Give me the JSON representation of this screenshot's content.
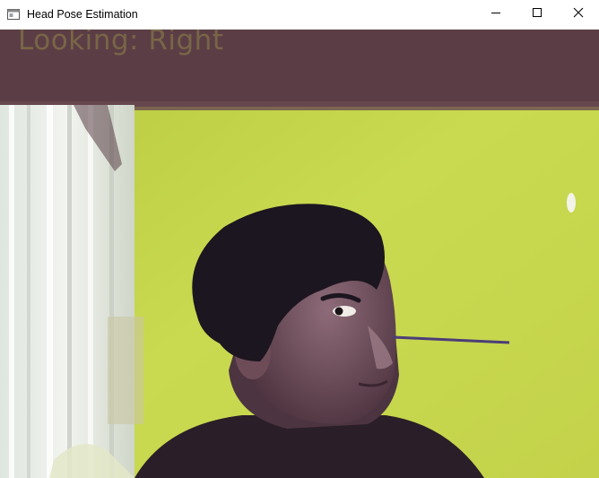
{
  "window": {
    "title": "Head Pose Estimation",
    "icons": {
      "app": "app-window-icon",
      "minimize": "minimize-icon",
      "maximize": "maximize-icon",
      "close": "close-icon"
    }
  },
  "video": {
    "pose_label": "Looking: Right",
    "pose_label_color": "#7c6a48",
    "direction_line_color": "#4b3d78",
    "colors": {
      "wall": "#c8d84e",
      "ceiling": "#5b3e45",
      "curtain": "#e8ece8",
      "hair": "#1c1620",
      "skin": "#6a4a55",
      "shirt": "#2a1e28"
    }
  }
}
